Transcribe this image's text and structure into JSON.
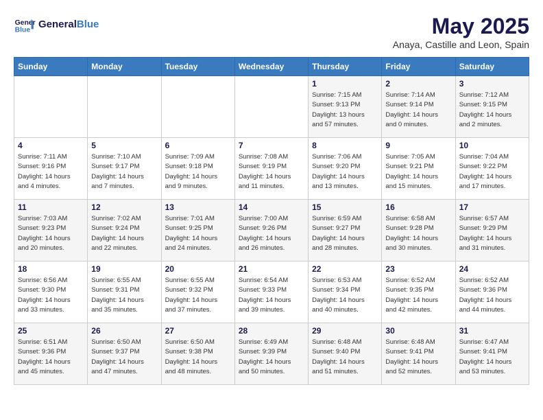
{
  "header": {
    "logo_line1": "General",
    "logo_line2": "Blue",
    "title": "May 2025",
    "subtitle": "Anaya, Castille and Leon, Spain"
  },
  "days_of_week": [
    "Sunday",
    "Monday",
    "Tuesday",
    "Wednesday",
    "Thursday",
    "Friday",
    "Saturday"
  ],
  "weeks": [
    [
      {
        "day": "",
        "info": ""
      },
      {
        "day": "",
        "info": ""
      },
      {
        "day": "",
        "info": ""
      },
      {
        "day": "",
        "info": ""
      },
      {
        "day": "1",
        "info": "Sunrise: 7:15 AM\nSunset: 9:13 PM\nDaylight: 13 hours\nand 57 minutes."
      },
      {
        "day": "2",
        "info": "Sunrise: 7:14 AM\nSunset: 9:14 PM\nDaylight: 14 hours\nand 0 minutes."
      },
      {
        "day": "3",
        "info": "Sunrise: 7:12 AM\nSunset: 9:15 PM\nDaylight: 14 hours\nand 2 minutes."
      }
    ],
    [
      {
        "day": "4",
        "info": "Sunrise: 7:11 AM\nSunset: 9:16 PM\nDaylight: 14 hours\nand 4 minutes."
      },
      {
        "day": "5",
        "info": "Sunrise: 7:10 AM\nSunset: 9:17 PM\nDaylight: 14 hours\nand 7 minutes."
      },
      {
        "day": "6",
        "info": "Sunrise: 7:09 AM\nSunset: 9:18 PM\nDaylight: 14 hours\nand 9 minutes."
      },
      {
        "day": "7",
        "info": "Sunrise: 7:08 AM\nSunset: 9:19 PM\nDaylight: 14 hours\nand 11 minutes."
      },
      {
        "day": "8",
        "info": "Sunrise: 7:06 AM\nSunset: 9:20 PM\nDaylight: 14 hours\nand 13 minutes."
      },
      {
        "day": "9",
        "info": "Sunrise: 7:05 AM\nSunset: 9:21 PM\nDaylight: 14 hours\nand 15 minutes."
      },
      {
        "day": "10",
        "info": "Sunrise: 7:04 AM\nSunset: 9:22 PM\nDaylight: 14 hours\nand 17 minutes."
      }
    ],
    [
      {
        "day": "11",
        "info": "Sunrise: 7:03 AM\nSunset: 9:23 PM\nDaylight: 14 hours\nand 20 minutes."
      },
      {
        "day": "12",
        "info": "Sunrise: 7:02 AM\nSunset: 9:24 PM\nDaylight: 14 hours\nand 22 minutes."
      },
      {
        "day": "13",
        "info": "Sunrise: 7:01 AM\nSunset: 9:25 PM\nDaylight: 14 hours\nand 24 minutes."
      },
      {
        "day": "14",
        "info": "Sunrise: 7:00 AM\nSunset: 9:26 PM\nDaylight: 14 hours\nand 26 minutes."
      },
      {
        "day": "15",
        "info": "Sunrise: 6:59 AM\nSunset: 9:27 PM\nDaylight: 14 hours\nand 28 minutes."
      },
      {
        "day": "16",
        "info": "Sunrise: 6:58 AM\nSunset: 9:28 PM\nDaylight: 14 hours\nand 30 minutes."
      },
      {
        "day": "17",
        "info": "Sunrise: 6:57 AM\nSunset: 9:29 PM\nDaylight: 14 hours\nand 31 minutes."
      }
    ],
    [
      {
        "day": "18",
        "info": "Sunrise: 6:56 AM\nSunset: 9:30 PM\nDaylight: 14 hours\nand 33 minutes."
      },
      {
        "day": "19",
        "info": "Sunrise: 6:55 AM\nSunset: 9:31 PM\nDaylight: 14 hours\nand 35 minutes."
      },
      {
        "day": "20",
        "info": "Sunrise: 6:55 AM\nSunset: 9:32 PM\nDaylight: 14 hours\nand 37 minutes."
      },
      {
        "day": "21",
        "info": "Sunrise: 6:54 AM\nSunset: 9:33 PM\nDaylight: 14 hours\nand 39 minutes."
      },
      {
        "day": "22",
        "info": "Sunrise: 6:53 AM\nSunset: 9:34 PM\nDaylight: 14 hours\nand 40 minutes."
      },
      {
        "day": "23",
        "info": "Sunrise: 6:52 AM\nSunset: 9:35 PM\nDaylight: 14 hours\nand 42 minutes."
      },
      {
        "day": "24",
        "info": "Sunrise: 6:52 AM\nSunset: 9:36 PM\nDaylight: 14 hours\nand 44 minutes."
      }
    ],
    [
      {
        "day": "25",
        "info": "Sunrise: 6:51 AM\nSunset: 9:36 PM\nDaylight: 14 hours\nand 45 minutes."
      },
      {
        "day": "26",
        "info": "Sunrise: 6:50 AM\nSunset: 9:37 PM\nDaylight: 14 hours\nand 47 minutes."
      },
      {
        "day": "27",
        "info": "Sunrise: 6:50 AM\nSunset: 9:38 PM\nDaylight: 14 hours\nand 48 minutes."
      },
      {
        "day": "28",
        "info": "Sunrise: 6:49 AM\nSunset: 9:39 PM\nDaylight: 14 hours\nand 50 minutes."
      },
      {
        "day": "29",
        "info": "Sunrise: 6:48 AM\nSunset: 9:40 PM\nDaylight: 14 hours\nand 51 minutes."
      },
      {
        "day": "30",
        "info": "Sunrise: 6:48 AM\nSunset: 9:41 PM\nDaylight: 14 hours\nand 52 minutes."
      },
      {
        "day": "31",
        "info": "Sunrise: 6:47 AM\nSunset: 9:41 PM\nDaylight: 14 hours\nand 53 minutes."
      }
    ]
  ]
}
